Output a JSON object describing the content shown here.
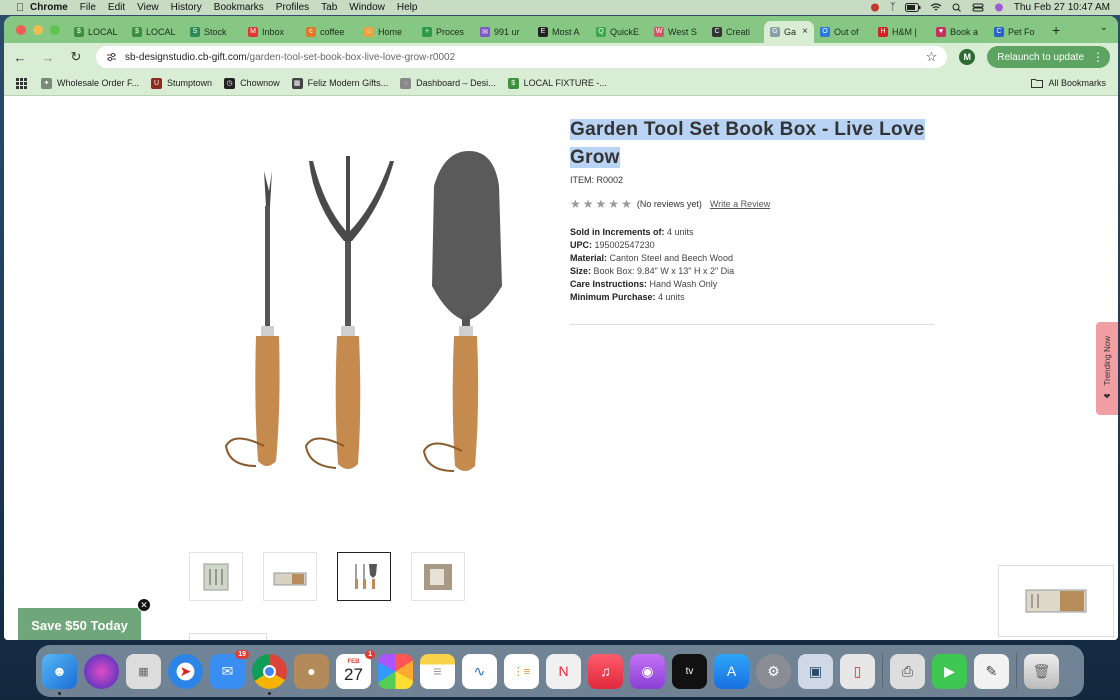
{
  "menubar": {
    "app_name": "Chrome",
    "items": [
      "File",
      "Edit",
      "View",
      "History",
      "Bookmarks",
      "Profiles",
      "Tab",
      "Window",
      "Help"
    ],
    "clock": "Thu Feb 27  10:47 AM"
  },
  "tabs": [
    {
      "label": "LOCAL",
      "color": "#3d8f3d",
      "glyph": "$"
    },
    {
      "label": "LOCAL",
      "color": "#3d8f3d",
      "glyph": "$"
    },
    {
      "label": "Stock",
      "color": "#2f8a5b",
      "glyph": "S"
    },
    {
      "label": "Inbox",
      "color": "#d93b30",
      "glyph": "M"
    },
    {
      "label": "coffee",
      "color": "#e07a2a",
      "glyph": "c"
    },
    {
      "label": "Home",
      "color": "#e8a33a",
      "glyph": "⌂"
    },
    {
      "label": "Proces",
      "color": "#2e9a4a",
      "glyph": "+"
    },
    {
      "label": "991 ur",
      "color": "#7f58c2",
      "glyph": "✉"
    },
    {
      "label": "Most A",
      "color": "#222222",
      "glyph": "E"
    },
    {
      "label": "QuickE",
      "color": "#3da64a",
      "glyph": "Q"
    },
    {
      "label": "West S",
      "color": "#d0576a",
      "glyph": "W"
    },
    {
      "label": "Creati",
      "color": "#333333",
      "glyph": "C"
    },
    {
      "label": "Ga",
      "color": "#8aa0a8",
      "glyph": "G",
      "active": true
    },
    {
      "label": "Out of",
      "color": "#2a7bd6",
      "glyph": "O"
    },
    {
      "label": "H&M |",
      "color": "#d22222",
      "glyph": "H"
    },
    {
      "label": "Book a",
      "color": "#c2335f",
      "glyph": "♥"
    },
    {
      "label": "Pet Fo",
      "color": "#2a62c9",
      "glyph": "C"
    }
  ],
  "toolbar": {
    "url_host": "sb-designstudio.cb-gift.com",
    "url_path": "/garden-tool-set-book-box-live-love-grow-r0002",
    "profile_initial": "M",
    "relaunch_label": "Relaunch to update"
  },
  "bookmarks": [
    {
      "label": "Wholesale Order F...",
      "color": "#7a8a7a",
      "glyph": "✦"
    },
    {
      "label": "Stumptown",
      "color": "#8a2b1d",
      "glyph": "U"
    },
    {
      "label": "Chownow",
      "color": "#222222",
      "glyph": "◷"
    },
    {
      "label": "Feliz Modern Gifts...",
      "color": "#444444",
      "glyph": "▦"
    },
    {
      "label": "Dashboard – Desi...",
      "color": "#888888",
      "glyph": "◌"
    },
    {
      "label": "LOCAL FIXTURE -...",
      "color": "#3d8f3d",
      "glyph": "$"
    }
  ],
  "all_bookmarks_label": "All Bookmarks",
  "product": {
    "title": "Garden Tool Set Book Box - Live Love Grow",
    "item_number": "ITEM: R0002",
    "reviews_text": "(No reviews yet)",
    "write_review": "Write a Review",
    "specs": [
      {
        "label": "Sold in Increments of:",
        "value": "4 units"
      },
      {
        "label": "UPC:",
        "value": "195002547230"
      },
      {
        "label": "Material:",
        "value": "Canton Steel and Beech Wood"
      },
      {
        "label": "Size:",
        "value": "Book Box: 9.84\" W x 13\" H x 2\" Dia"
      },
      {
        "label": "Care Instructions:",
        "value": "Hand Wash Only"
      },
      {
        "label": "Minimum Purchase:",
        "value": "4 units"
      }
    ]
  },
  "trending_label": "Trending Now",
  "save_banner": "Save $50 Today",
  "dock": {
    "mail_badge": "19",
    "calendar_month": "FEB",
    "calendar_day": "27",
    "calendar_badge": "1"
  }
}
